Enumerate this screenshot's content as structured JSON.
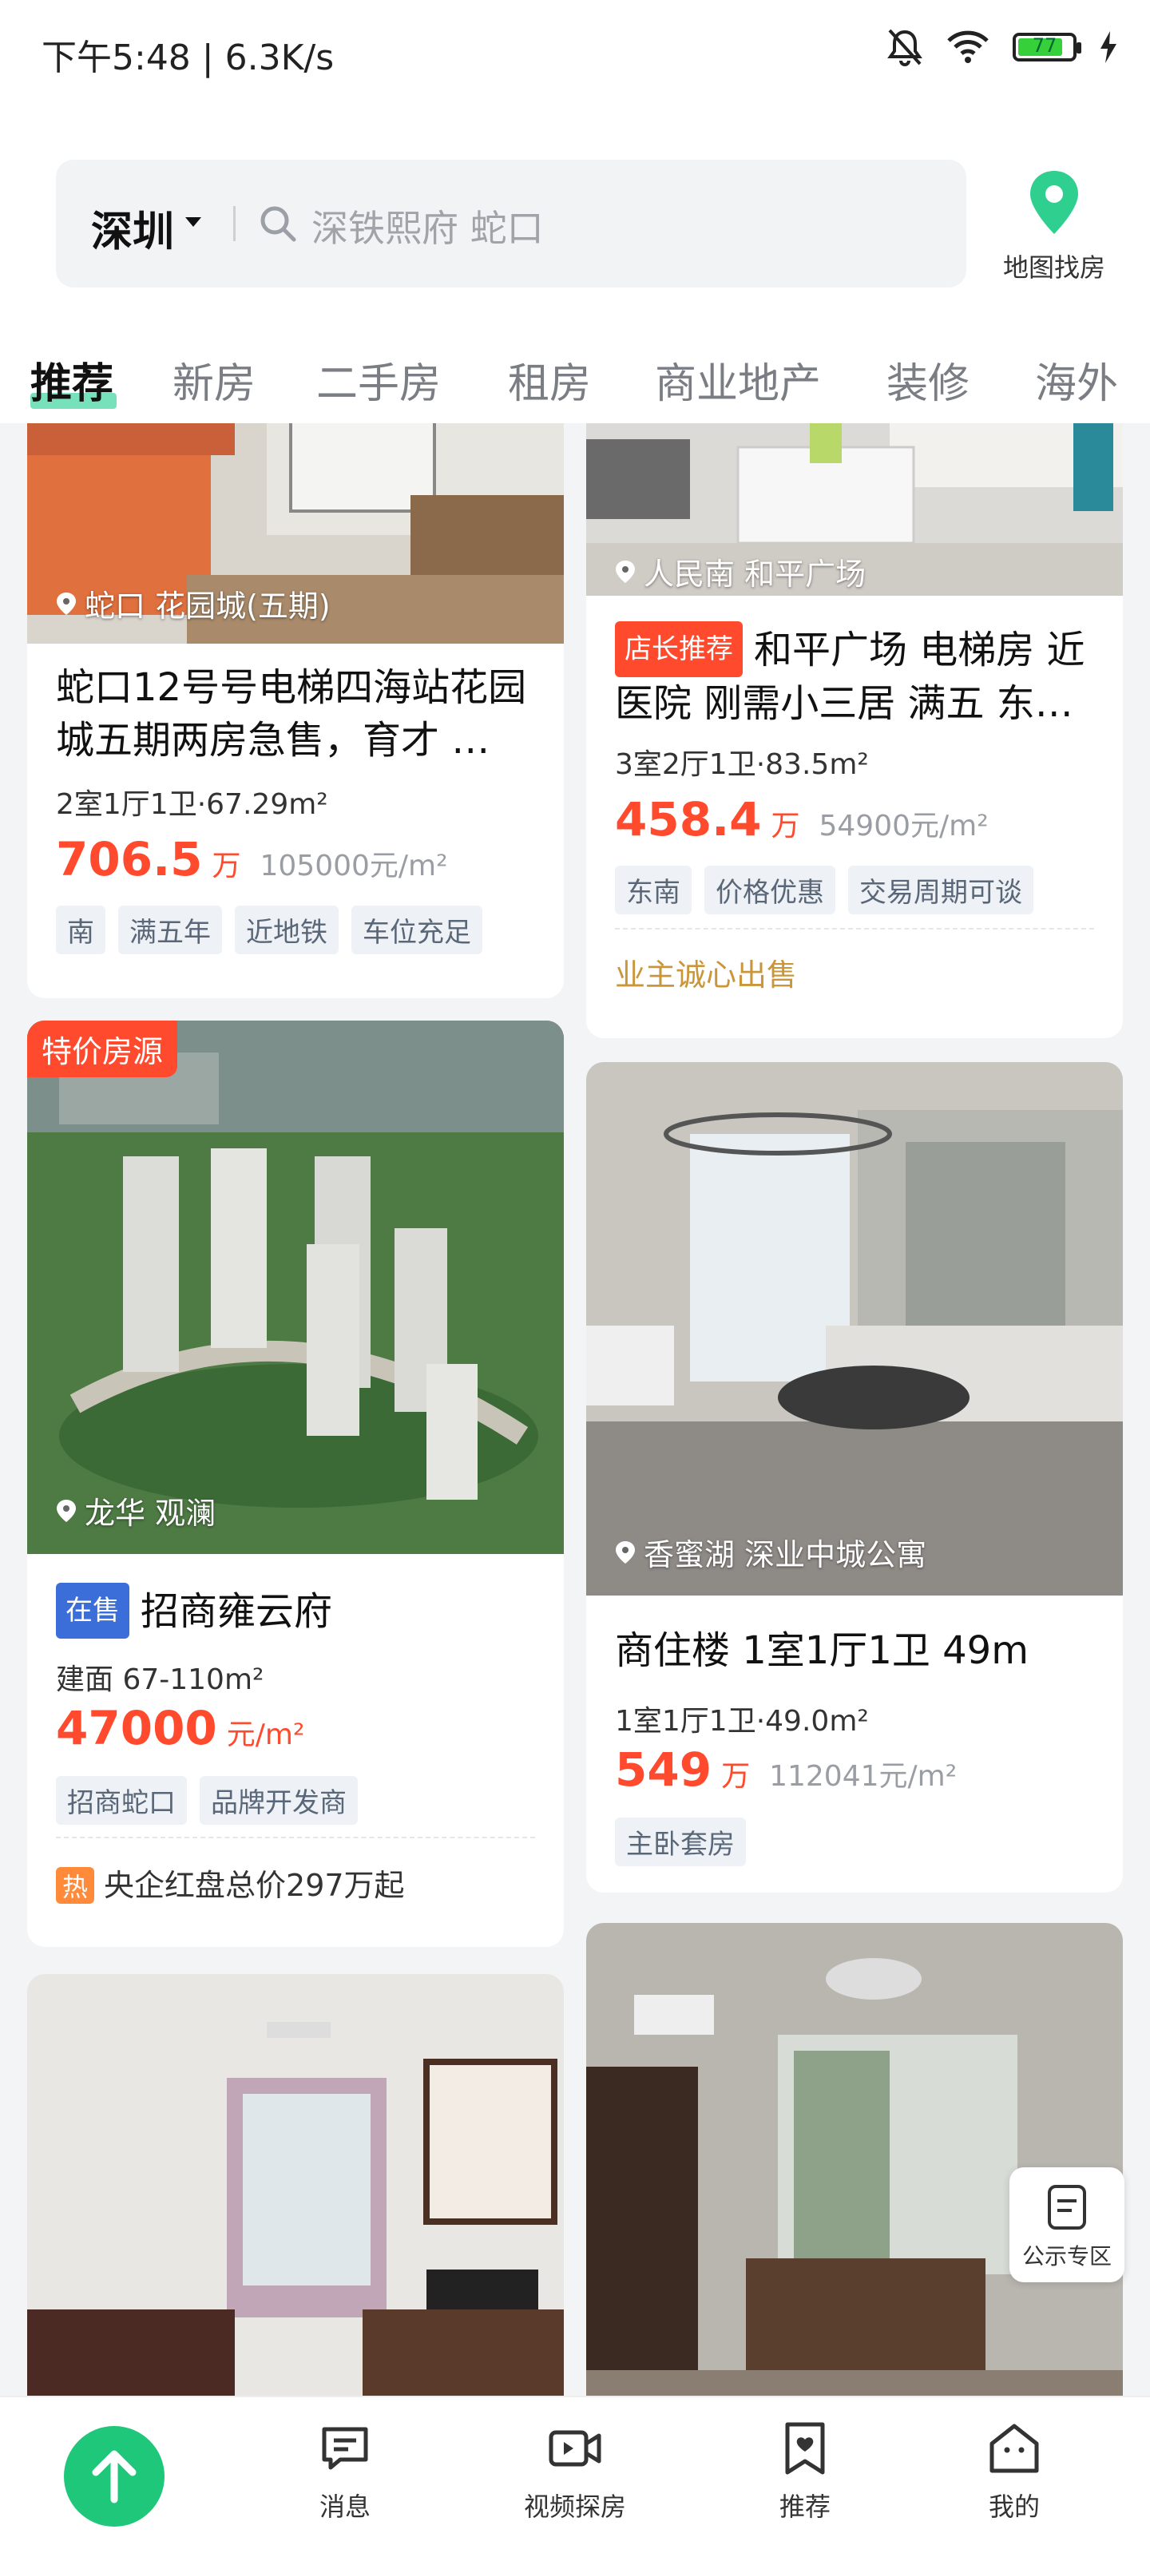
{
  "status": {
    "time_speed": "下午5:48 | 6.3K/s",
    "battery": "77",
    "colors": {
      "battery_fill": "#36d13a"
    }
  },
  "search": {
    "city": "深圳",
    "placeholder": "深铁熙府 蛇口",
    "map_label": "地图找房"
  },
  "tabs": [
    {
      "label": "推荐",
      "active": true
    },
    {
      "label": "新房"
    },
    {
      "label": "二手房"
    },
    {
      "label": "租房"
    },
    {
      "label": "商业地产"
    },
    {
      "label": "装修"
    },
    {
      "label": "海外"
    }
  ],
  "cards": {
    "c1": {
      "location": "蛇口 花园城(五期)",
      "title": "蛇口12号号电梯四海站花园城五期两房急售，育才 …",
      "spec": "2室1厅1卫·67.29m²",
      "price": "706.5",
      "price_unit": "万",
      "unit_price": "105000元/m²",
      "tags": [
        "南",
        "满五年",
        "近地铁",
        "车位充足"
      ]
    },
    "c2": {
      "location": "人民南 和平广场",
      "badge": "店长推荐",
      "title": "和平广场 电梯房 近医院 刚需小三居 满五 东…",
      "spec": "3室2厅1卫·83.5m²",
      "price": "458.4",
      "price_unit": "万",
      "unit_price": "54900元/m²",
      "tags": [
        "东南",
        "价格优惠",
        "交易周期可谈"
      ],
      "note": "业主诚心出售"
    },
    "c3": {
      "ribbon": "特价房源",
      "location": "龙华 观澜",
      "badge": "在售",
      "title": "招商雍云府",
      "spec": "建面 67-110m²",
      "price": "47000",
      "price_unit": "元/m²",
      "tags": [
        "招商蛇口",
        "品牌开发商"
      ],
      "hot": "热",
      "note": "央企红盘总价297万起"
    },
    "c4": {
      "location": "香蜜湖 深业中城公寓",
      "title": "商住楼 1室1厅1卫 49m",
      "spec": "1室1厅1卫·49.0m²",
      "price": "549",
      "price_unit": "万",
      "unit_price": "112041元/m²",
      "tags": [
        "主卧套房"
      ]
    }
  },
  "float": {
    "label": "公示专区"
  },
  "nav": [
    {
      "label": "消息",
      "icon": "message-icon"
    },
    {
      "label": "视频探房",
      "icon": "video-icon"
    },
    {
      "label": "推荐",
      "icon": "bookmark-heart-icon"
    },
    {
      "label": "我的",
      "icon": "profile-icon"
    }
  ],
  "colors": {
    "accent": "#1ec77a",
    "price": "#ff4a2e",
    "note_gold": "#c9963a"
  }
}
